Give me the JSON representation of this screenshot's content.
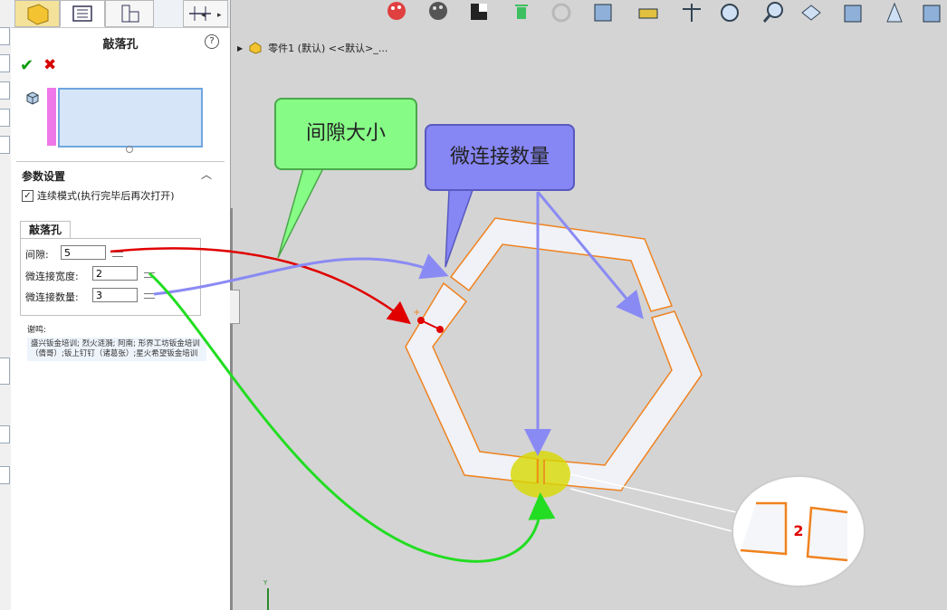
{
  "panel": {
    "title": "敲落孔",
    "help_label": "?",
    "section_title": "参数设置",
    "continuous_mode_label": "连续模式(执行完毕后再次打开)",
    "continuous_mode_checked": true,
    "group_title": "敲落孔",
    "fields": [
      {
        "label": "间隙:",
        "value": "5"
      },
      {
        "label": "微连接宽度:",
        "value": "2"
      },
      {
        "label": "微连接数量:",
        "value": "3"
      }
    ],
    "thanks_title": "谢鸣:",
    "thanks_body": "盛兴钣金培训; 烈火涟漪; 阿南; 形界工坊钣金培训（倩哥）;钣上钉钉（诸葛张）;星火希望钣金培训"
  },
  "breadcrumb": {
    "text": "零件1 (默认) <<默认>_..."
  },
  "annotations": {
    "gap_label": "间隙大小",
    "count_label": "微连接数量",
    "zoom_number": "2"
  },
  "axis": {
    "y_label": "Y"
  },
  "colors": {
    "green_callout": "#86fb86",
    "blue_callout": "#8686f4",
    "orange_outline": "#f0821e",
    "yellow_highlight": "#d8d800"
  },
  "toolbar_icons": [
    "appearance-icon",
    "palette-icon",
    "render-icon",
    "delete-icon",
    "fillet-icon",
    "component-icon",
    "measure-icon",
    "balance-icon",
    "zoom-fit-icon",
    "zoom-icon",
    "previous-view-icon",
    "section-icon",
    "display-icon",
    "view-cube-icon"
  ]
}
